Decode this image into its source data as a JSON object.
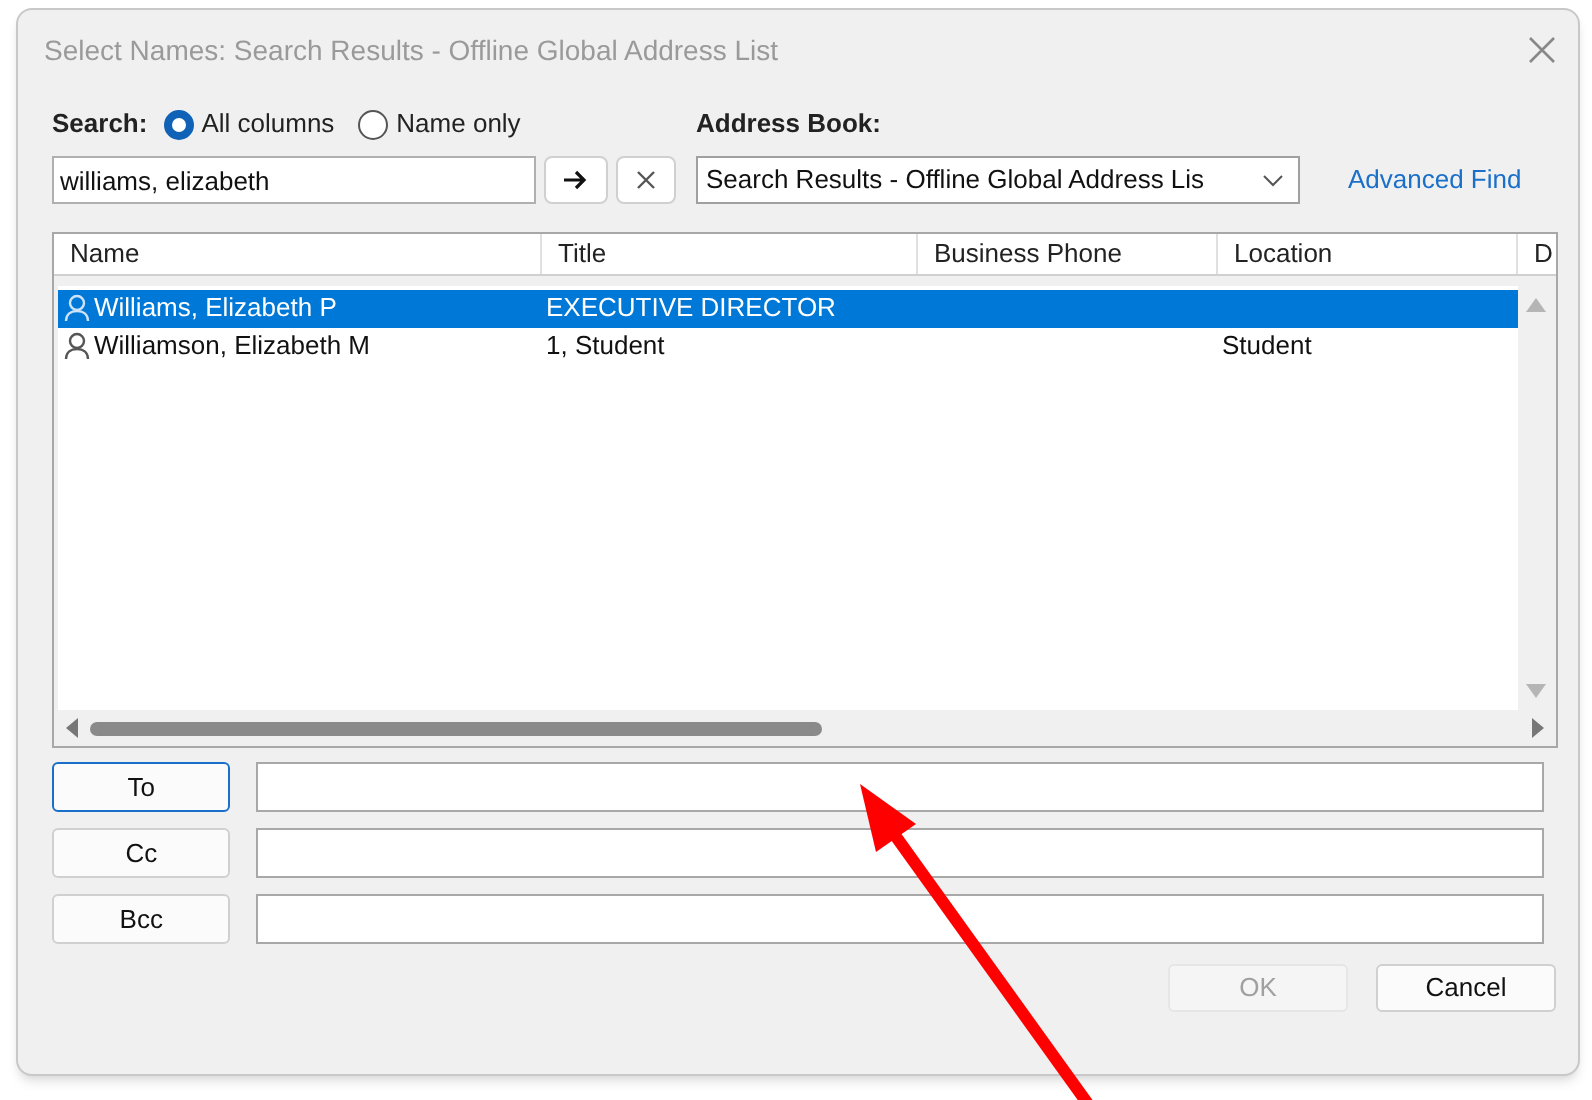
{
  "window": {
    "title": "Select Names: Search Results - Offline Global Address List"
  },
  "search": {
    "label": "Search:",
    "options": [
      {
        "label": "All columns",
        "selected": true
      },
      {
        "label": "Name only",
        "selected": false
      }
    ],
    "value": "williams, elizabeth"
  },
  "address_book": {
    "label": "Address Book:",
    "value": "Search Results - Offline Global Address Lis"
  },
  "advanced_find": "Advanced Find",
  "table": {
    "columns": [
      "Name",
      "Title",
      "Business Phone",
      "Location",
      "D"
    ],
    "rows": [
      {
        "cells": [
          "Williams, Elizabeth P",
          "EXECUTIVE DIRECTOR",
          null,
          null
        ],
        "selected": true
      },
      {
        "cells": [
          "Williamson, Elizabeth M",
          "1, Student",
          null,
          "Student"
        ],
        "selected": false
      }
    ]
  },
  "recipients": [
    {
      "label": "To",
      "focused": true
    },
    {
      "label": "Cc",
      "focused": false
    },
    {
      "label": "Bcc",
      "focused": false
    }
  ],
  "buttons": [
    {
      "label": "OK",
      "disabled": true
    },
    {
      "label": "Cancel",
      "disabled": false
    }
  ]
}
